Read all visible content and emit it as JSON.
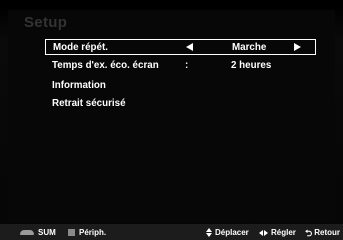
{
  "menu": {
    "title": "Setup",
    "items": [
      {
        "label": "Mode répét.",
        "value": "Marche",
        "selected": true
      },
      {
        "label": "Temps d'ex. éco. écran",
        "separator": ":",
        "value": "2 heures"
      },
      {
        "label": "Information"
      },
      {
        "label": "Retrait sécurisé"
      }
    ]
  },
  "footer": {
    "sum_label": "SUM",
    "periph_label": "Périph.",
    "move_label": "Déplacer",
    "adjust_label": "Régler",
    "return_label": "Retour"
  },
  "icons": [
    "sum-icon",
    "periph-icon",
    "updown-icon",
    "leftright-icon",
    "return-icon"
  ],
  "colors": {
    "background": "#000000",
    "text": "#ffffff",
    "title": "#333333",
    "footer_bg": "#1c1c1c"
  }
}
